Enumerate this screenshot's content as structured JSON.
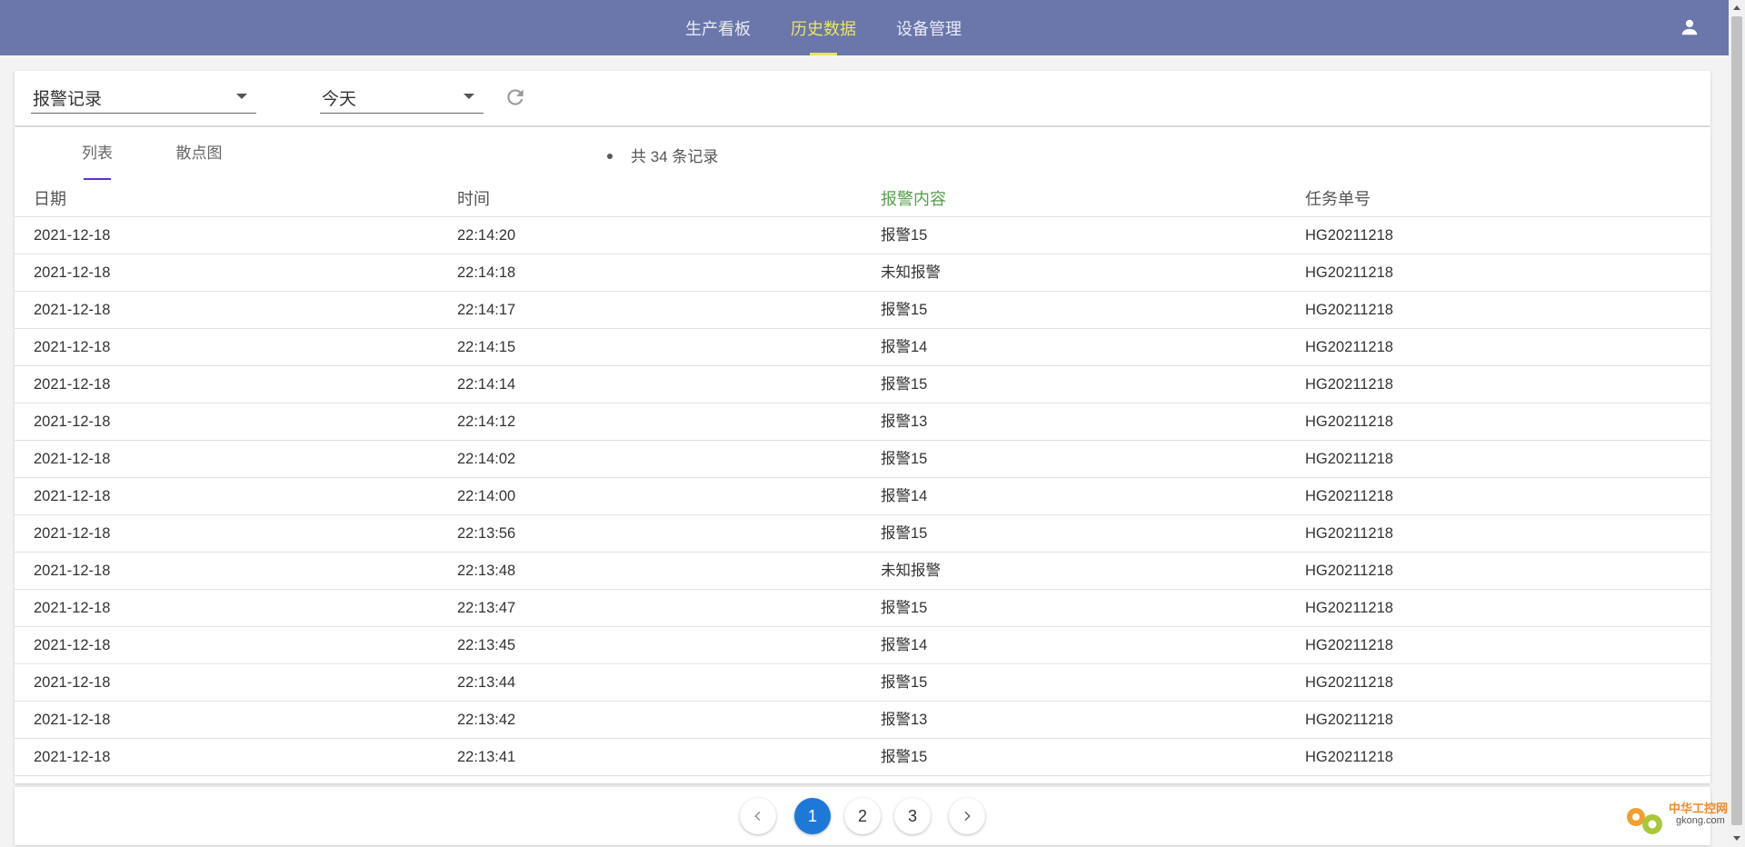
{
  "nav": {
    "tabs": [
      {
        "label": "生产看板",
        "active": false
      },
      {
        "label": "历史数据",
        "active": true
      },
      {
        "label": "设备管理",
        "active": false
      }
    ],
    "user_icon": "user-icon"
  },
  "filters": {
    "type_select": "报警记录",
    "range_select": "今天",
    "refresh_icon": "refresh-icon"
  },
  "view_tabs": [
    {
      "label": "列表",
      "active": true
    },
    {
      "label": "散点图",
      "active": false
    }
  ],
  "record_count": "共 34 条记录",
  "table": {
    "columns": [
      "日期",
      "时间",
      "报警内容",
      "任务单号"
    ],
    "rows": [
      [
        "2021-12-18",
        "22:14:20",
        "报警15",
        "HG20211218"
      ],
      [
        "2021-12-18",
        "22:14:18",
        "未知报警",
        "HG20211218"
      ],
      [
        "2021-12-18",
        "22:14:17",
        "报警15",
        "HG20211218"
      ],
      [
        "2021-12-18",
        "22:14:15",
        "报警14",
        "HG20211218"
      ],
      [
        "2021-12-18",
        "22:14:14",
        "报警15",
        "HG20211218"
      ],
      [
        "2021-12-18",
        "22:14:12",
        "报警13",
        "HG20211218"
      ],
      [
        "2021-12-18",
        "22:14:02",
        "报警15",
        "HG20211218"
      ],
      [
        "2021-12-18",
        "22:14:00",
        "报警14",
        "HG20211218"
      ],
      [
        "2021-12-18",
        "22:13:56",
        "报警15",
        "HG20211218"
      ],
      [
        "2021-12-18",
        "22:13:48",
        "未知报警",
        "HG20211218"
      ],
      [
        "2021-12-18",
        "22:13:47",
        "报警15",
        "HG20211218"
      ],
      [
        "2021-12-18",
        "22:13:45",
        "报警14",
        "HG20211218"
      ],
      [
        "2021-12-18",
        "22:13:44",
        "报警15",
        "HG20211218"
      ],
      [
        "2021-12-18",
        "22:13:42",
        "报警13",
        "HG20211218"
      ],
      [
        "2021-12-18",
        "22:13:41",
        "报警15",
        "HG20211218"
      ]
    ]
  },
  "pagination": {
    "pages": [
      "1",
      "2",
      "3"
    ],
    "current": "1"
  },
  "watermark": {
    "line1": "中华工控网",
    "line2": "gkong.com"
  },
  "colors": {
    "topbar": "#6b76ab",
    "nav_active": "#e9e463",
    "header_highlight": "#55a04c",
    "tab_indicator": "#5b32c8",
    "page_active": "#1e78d8"
  }
}
